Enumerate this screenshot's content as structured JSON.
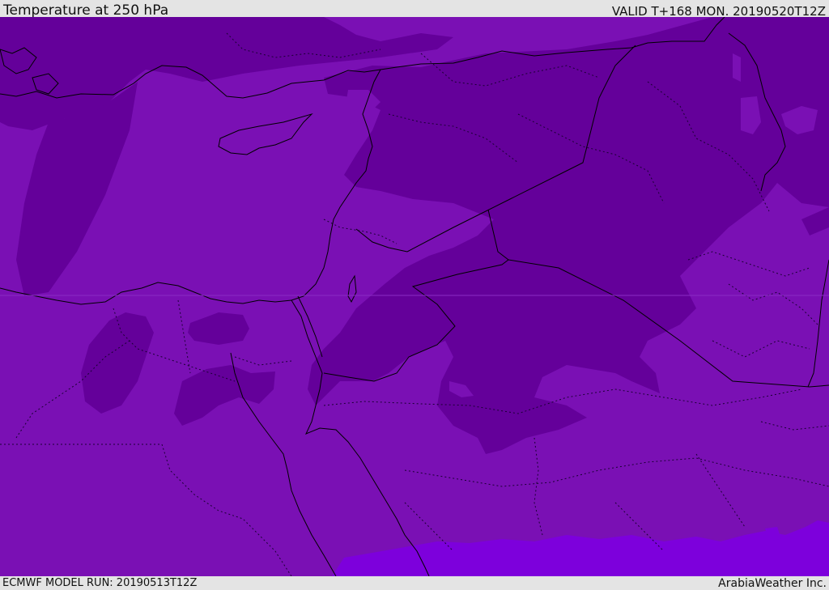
{
  "header": {
    "title": "Temperature at 250 hPa",
    "valid": "VALID T+168 MON. 20190520T12Z"
  },
  "footer": {
    "model_run": "ECMWF MODEL RUN: 20190513T12Z",
    "credit": "ArabiaWeather Inc."
  },
  "colors": {
    "background_fill": "#7a10b4",
    "colder_fill": "#64009a",
    "warmer_fill": "#7d00dc",
    "coastline": "#000000",
    "border_dotted": "#1a0033",
    "bar_background": "#e4e4e4"
  }
}
